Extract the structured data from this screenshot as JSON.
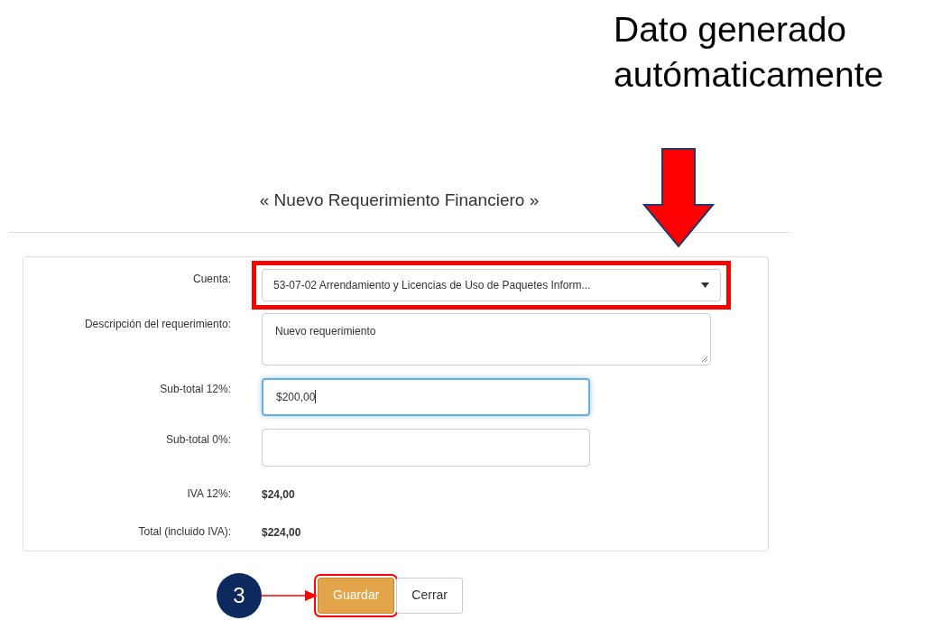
{
  "annotation": {
    "lines": [
      "Dato generado",
      "autómaticamente"
    ]
  },
  "dialog": {
    "title": "« Nuevo Requerimiento Financiero »",
    "fields": [
      {
        "kind": "select",
        "label": "Cuenta:",
        "value": "53-07-02 Arrendamiento y Licencias de Uso de Paquetes Inform...",
        "highlighted": true
      },
      {
        "kind": "textarea",
        "label": "Descripción del requerimiento:",
        "value": "Nuevo requerimiento"
      },
      {
        "kind": "input",
        "label": "Sub-total 12%:",
        "value": "$200,00",
        "focused": true
      },
      {
        "kind": "input",
        "label": "Sub-total 0%:",
        "focused": false
      },
      {
        "kind": "static",
        "label": "IVA 12%:",
        "value": "$24,00"
      },
      {
        "kind": "static",
        "label": "Total (incluido IVA):",
        "value": "$224,00"
      }
    ],
    "step_badge": "3",
    "buttons": [
      {
        "label": "Guardar",
        "kind": "primary",
        "highlighted": true
      },
      {
        "label": "Cerrar",
        "kind": "default",
        "highlighted": false
      }
    ]
  }
}
